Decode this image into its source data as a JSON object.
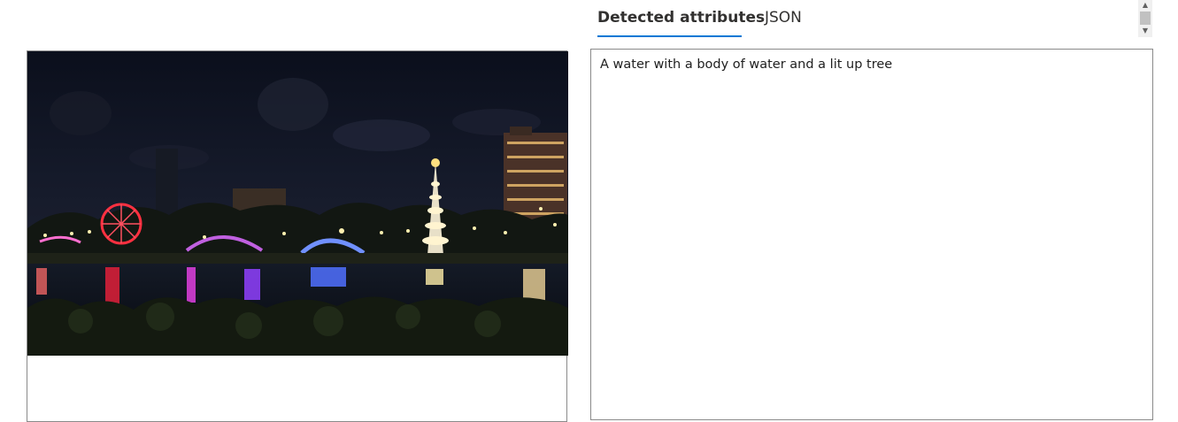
{
  "tabs": {
    "detected_attributes": "Detected attributes",
    "json": "JSON"
  },
  "result": {
    "caption": "A water with a body of water and a lit up tree"
  },
  "image": {
    "subject": "night-waterfront-festival-lights-photo"
  },
  "scrollbar": {
    "up_arrow": "▲",
    "down_arrow": "▼"
  },
  "colors": {
    "accent": "#0078d4",
    "border": "#8a8a8a",
    "sky": "#0f1422",
    "water": "#0a0d18"
  }
}
